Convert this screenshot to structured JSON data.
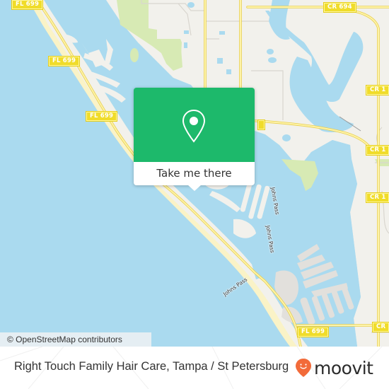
{
  "map": {
    "road_shields": [
      {
        "label": "FL 699"
      },
      {
        "label": "FL 699"
      },
      {
        "label": "FL 699"
      },
      {
        "label": "FL 699"
      },
      {
        "label": "CR 694"
      },
      {
        "label": "CR 1"
      },
      {
        "label": "CR 1"
      },
      {
        "label": "CR 1"
      },
      {
        "label": "CR 1"
      },
      {
        "label": "CR"
      }
    ],
    "water_labels": [
      {
        "label": "Johns Pass"
      },
      {
        "label": "Johns Pass"
      },
      {
        "label": "Johns Pass"
      }
    ],
    "attribution": "© OpenStreetMap contributors",
    "colors": {
      "water": "#aadaef",
      "land": "#f2f1ec",
      "park": "#d7eab4",
      "road": "#f5e37a",
      "shield": "#f0dc2a",
      "beach": "#faf3c7"
    }
  },
  "popup": {
    "icon": "location-pin-icon",
    "action_label": "Take me there",
    "color": "#1db96b"
  },
  "footer": {
    "title": "Right Touch Family Hair Care, Tampa / St Petersburg",
    "brand": "moovit",
    "brand_icon": "moovit-smiley-pin-icon",
    "brand_color": "#f26b3a"
  }
}
